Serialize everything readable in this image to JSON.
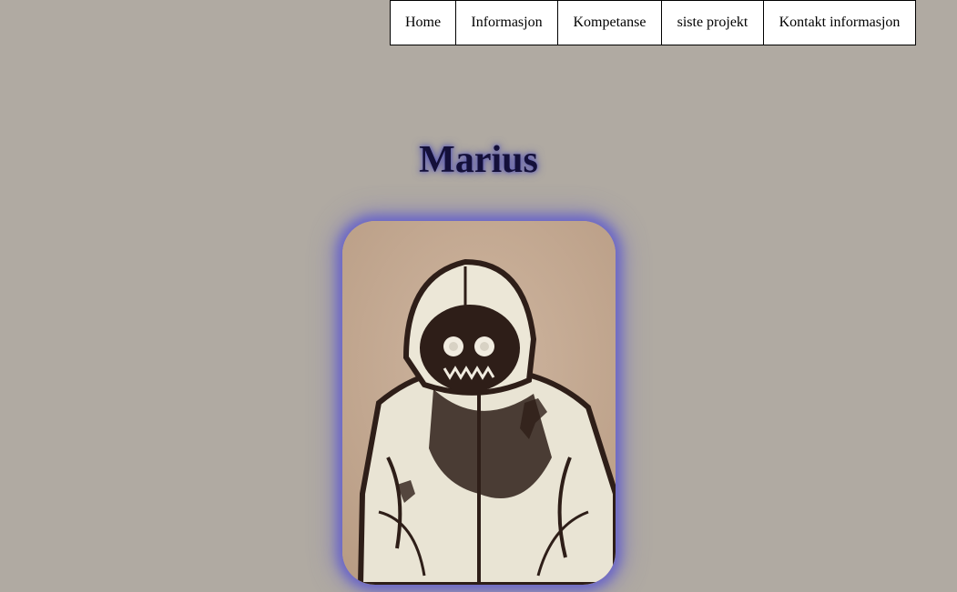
{
  "nav": {
    "items": [
      {
        "label": "Home"
      },
      {
        "label": "Informasjon"
      },
      {
        "label": "Kompetanse"
      },
      {
        "label": "siste projekt"
      },
      {
        "label": "Kontakt informasjon"
      }
    ]
  },
  "header": {
    "title": "Marius"
  },
  "colors": {
    "background": "#b0aaa2",
    "title": "#14103a",
    "glow": "#6a66c8"
  }
}
